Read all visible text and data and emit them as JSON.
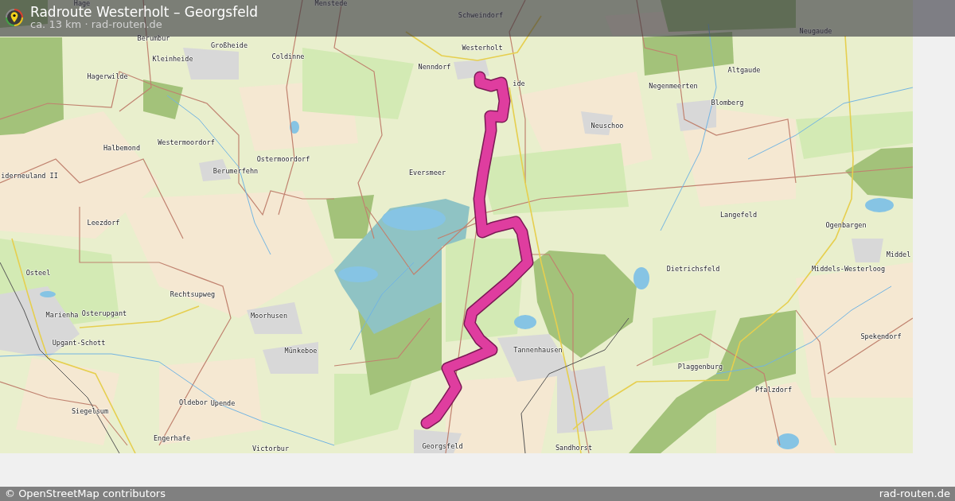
{
  "header": {
    "title": "Radroute Westerholt – Georgsfeld",
    "subtitle": "ca. 13 km · rad-routen.de"
  },
  "map": {
    "places": [
      {
        "name": "Hage"
      },
      {
        "name": "Menstede"
      },
      {
        "name": "Schweindorf"
      },
      {
        "name": "Neugaude"
      },
      {
        "name": "Berumbur"
      },
      {
        "name": "Großheide"
      },
      {
        "name": "Westerholt"
      },
      {
        "name": "Kleinheide"
      },
      {
        "name": "Coldinne"
      },
      {
        "name": "Nenndorf"
      },
      {
        "name": "Altgaude"
      },
      {
        "name": "Hagerwilde"
      },
      {
        "name": "ide"
      },
      {
        "name": "Negenmeerten"
      },
      {
        "name": "Blomberg"
      },
      {
        "name": "Neuschoo"
      },
      {
        "name": "Westermoordorf"
      },
      {
        "name": "Halbemond"
      },
      {
        "name": "Ostermoordorf"
      },
      {
        "name": "iderneuland II"
      },
      {
        "name": "Berumerfehn"
      },
      {
        "name": "Eversmeer"
      },
      {
        "name": "Langefeld"
      },
      {
        "name": "Leezdorf"
      },
      {
        "name": "Ogenbargen"
      },
      {
        "name": "Middel"
      },
      {
        "name": "Osteel"
      },
      {
        "name": "Dietrichsfeld"
      },
      {
        "name": "Middels-Westerloog"
      },
      {
        "name": "Rechtsupweg"
      },
      {
        "name": "Marienha"
      },
      {
        "name": "Osterupgant"
      },
      {
        "name": "Moorhusen"
      },
      {
        "name": "Spekendorf"
      },
      {
        "name": "Upgant-Schott"
      },
      {
        "name": "Münkeboe"
      },
      {
        "name": "Tannenhausen"
      },
      {
        "name": "Plaggenburg"
      },
      {
        "name": "Pfalzdorf"
      },
      {
        "name": "Oldebor"
      },
      {
        "name": "Upende"
      },
      {
        "name": "Siegelsum"
      },
      {
        "name": "Engerhafe"
      },
      {
        "name": "Victorbur"
      },
      {
        "name": "Georgsfeld"
      },
      {
        "name": "Sandhorst"
      }
    ]
  },
  "footer": {
    "attribution": "© OpenStreetMap contributors",
    "site": "rad-routen.de"
  }
}
